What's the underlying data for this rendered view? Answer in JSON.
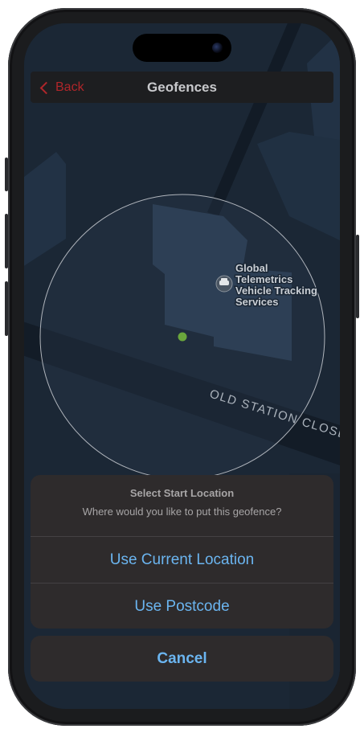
{
  "nav": {
    "back_label": "Back",
    "title": "Geofences"
  },
  "map": {
    "poi_lines": [
      "Global",
      "Telemetrics",
      "Vehicle Tracking",
      "Services"
    ],
    "road_label": "OLD STATION CLOSE",
    "poi_icon": "car-icon",
    "geofence_color": "#c9cdd2",
    "center_marker_color": "#6aa63c"
  },
  "action_sheet": {
    "title": "Select Start Location",
    "message": "Where would you like to put this geofence?",
    "options": [
      "Use Current Location",
      "Use Postcode"
    ],
    "cancel_label": "Cancel"
  },
  "colors": {
    "accent_blue": "#6bb5f0",
    "back_red": "#b0262a"
  }
}
